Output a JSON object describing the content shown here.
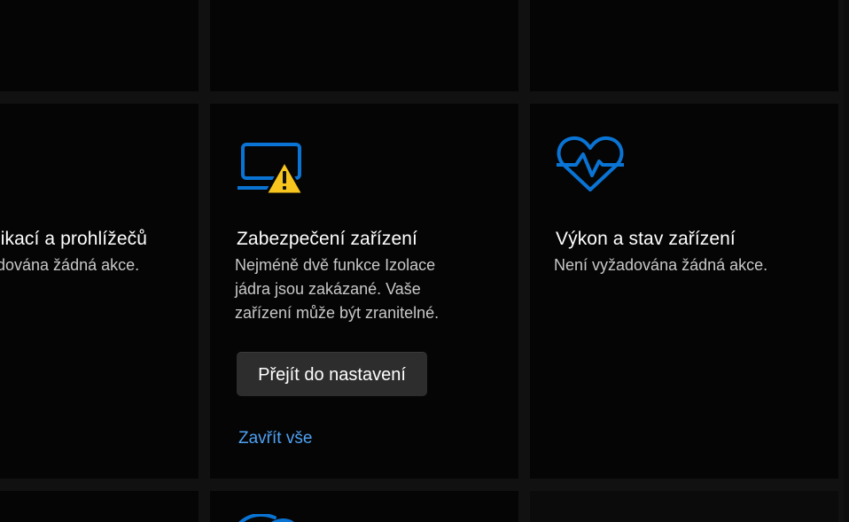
{
  "cards": {
    "app_browser": {
      "title": "likací a prohlížečů",
      "status": "dována žádná akce."
    },
    "device_security": {
      "title": "Zabezpečení zařízení",
      "description_lines": [
        "Nejméně dvě funkce Izolace",
        "jádra jsou zakázané. Vaše",
        "zařízení může být zranitelné."
      ],
      "action_button": "Přejít do nastavení",
      "dismiss_link": "Zavřít vše"
    },
    "device_performance": {
      "title": "Výkon a stav zařízení",
      "status": "Není vyžadována žádná akce."
    }
  },
  "icons": {
    "device_security": "laptop-warning-icon",
    "device_performance": "heart-pulse-icon",
    "bottom_partial": "partial-blue-icon"
  },
  "colors": {
    "accent": "#0a74d4",
    "link": "#4ea1f3",
    "warning": "#f7c51e",
    "tile": "#050505",
    "gap": "#111111"
  }
}
